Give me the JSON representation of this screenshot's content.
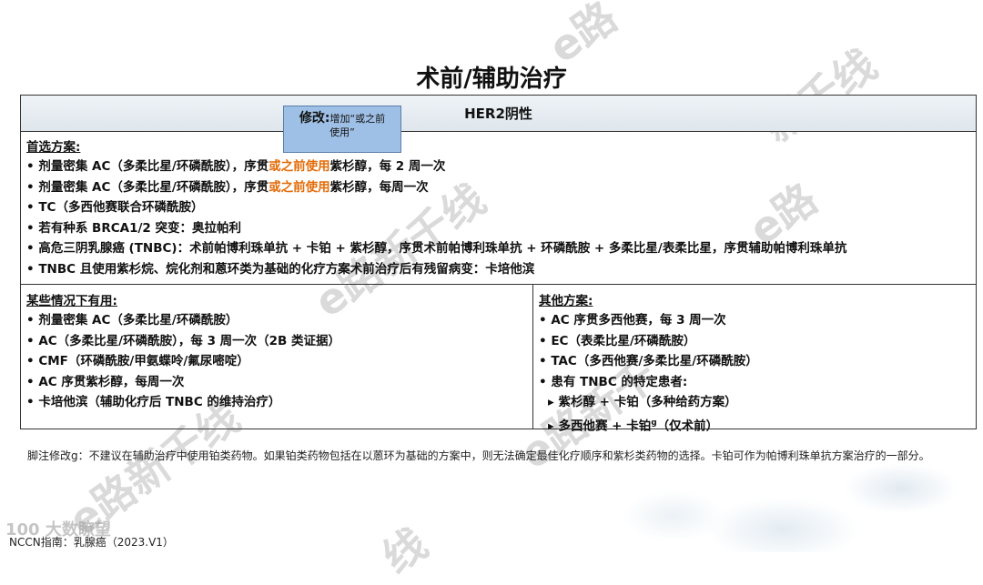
{
  "title": "术前/辅助治疗",
  "header": "HER2阴性",
  "note": {
    "bold": "修改:",
    "text1": "增加“或之前",
    "text2": "使用”"
  },
  "preferred": {
    "heading": "首选方案:",
    "items": [
      {
        "pre": "• 剂量密集 AC（多柔比星/环磷酰胺），序贯",
        "hl": "或之前使用",
        "post": "紫杉醇，每 2 周一次"
      },
      {
        "pre": "• 剂量密集 AC（多柔比星/环磷酰胺），序贯",
        "hl": "或之前使用",
        "post": "紫杉醇，每周一次"
      },
      {
        "pre": "• TC（多西他赛联合环磷酰胺）",
        "hl": "",
        "post": ""
      },
      {
        "pre": "• 若有种系 BRCA1/2 突变：奥拉帕利",
        "hl": "",
        "post": ""
      },
      {
        "pre": "• 高危三阴乳腺癌 (TNBC)：术前帕博利珠单抗 + 卡铂 + 紫杉醇，序贯术前帕博利珠单抗 + 环磷酰胺 + 多柔比星/表柔比星，序贯辅助帕博利珠单抗",
        "hl": "",
        "post": ""
      },
      {
        "pre": "• TNBC 且使用紫杉烷、烷化剂和蒽环类为基础的化疗方案术前治疗后有残留病变：卡培他滨",
        "hl": "",
        "post": ""
      }
    ]
  },
  "useful": {
    "heading": "某些情况下有用:",
    "items": [
      "• 剂量密集 AC（多柔比星/环磷酰胺）",
      "• AC（多柔比星/环磷酰胺），每 3 周一次（2B 类证据）",
      "• CMF（环磷酰胺/甲氨蝶呤/氟尿嘧啶）",
      "• AC 序贯紫杉醇，每周一次",
      "• 卡培他滨（辅助化疗后 TNBC 的维持治疗）"
    ]
  },
  "other": {
    "heading": "其他方案:",
    "items": [
      "• AC 序贯多西他赛，每 3 周一次",
      "• EC（表柔比星/环磷酰胺）",
      "• TAC（多西他赛/多柔比星/环磷酰胺）",
      "• 患有 TNBC 的特定患者:"
    ],
    "subitems": [
      {
        "text": "▸ 紫杉醇 + 卡铂（多种给药方案）",
        "sup": ""
      },
      {
        "text": "▸ 多西他赛 + 卡铂",
        "sup": "g",
        "post": "（仅术前）"
      }
    ]
  },
  "footnote": "脚注修改g：不建议在辅助治疗中使用铂类药物。如果铂类药物包括在以蒽环为基础的方案中，则无法确定最佳化疗顺序和紫杉类药物的选择。卡铂可作为帕博利珠单抗方案治疗的一部分。",
  "source": "NCCN指南：乳腺癌（2023.V1）",
  "brand": "100 大数瞭望"
}
